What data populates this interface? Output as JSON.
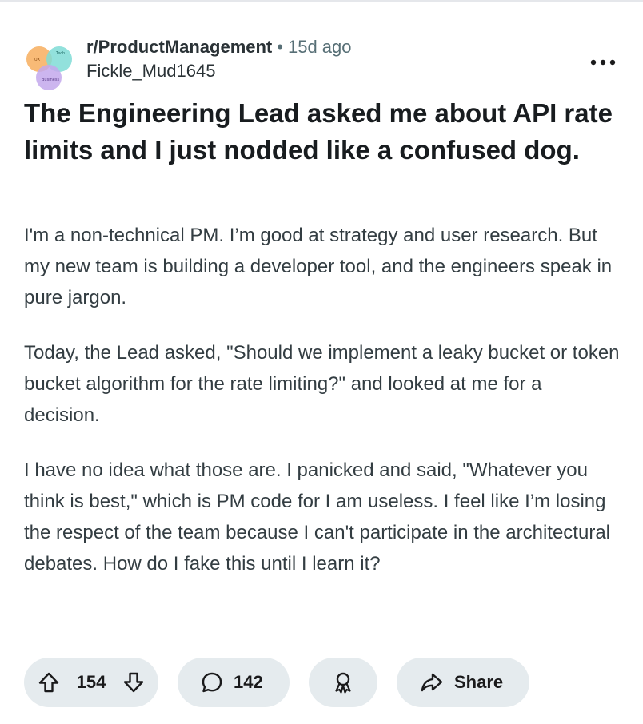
{
  "post": {
    "subreddit": "r/ProductManagement",
    "separator": "•",
    "age": "15d ago",
    "author": "Fickle_Mud1645",
    "avatar_labels": [
      "UX",
      "Tech",
      "Business"
    ],
    "title": "The Engineering Lead asked me about API rate limits and I just nodded like a confused dog.",
    "paragraphs": [
      "I'm a non-technical PM. I’m good at strategy and user research. But my new team is building a developer tool, and the engineers speak in pure jargon.",
      "Today, the Lead asked, \"Should we implement a leaky bucket or token bucket algorithm for the rate limiting?\" and looked at me for a decision.",
      "I have no idea what those are. I panicked and said, \"Whatever you think is best,\" which is PM code for I am useless. I feel like I’m losing the respect of the team because I can't participate in the architectural debates. How do I fake this until I learn it?"
    ]
  },
  "actions": {
    "vote_count": "154",
    "comment_count": "142",
    "share_label": "Share"
  },
  "icons": {
    "more": "more-horizontal-icon",
    "upvote": "upvote-arrow-icon",
    "downvote": "downvote-arrow-icon",
    "comment": "comment-bubble-icon",
    "award": "award-icon",
    "share": "share-arrow-icon"
  },
  "colors": {
    "pill_background": "#e5ebee",
    "title_text": "#181c1f",
    "body_text": "#333d42",
    "meta_text": "#576f76",
    "avatar_orange": "#f7b267",
    "avatar_teal": "#7fdcd6",
    "avatar_purple": "#c3a8ec"
  }
}
